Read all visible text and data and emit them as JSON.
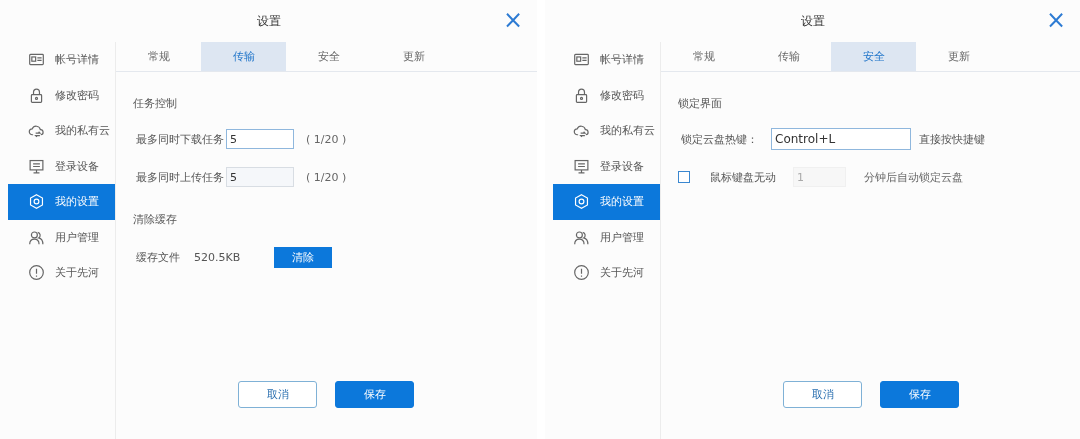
{
  "dialogs": [
    {
      "title": "设置",
      "close": "×",
      "sidebar": [
        {
          "label": "帐号详情",
          "selected": false
        },
        {
          "label": "修改密码",
          "selected": false
        },
        {
          "label": "我的私有云",
          "selected": false
        },
        {
          "label": "登录设备",
          "selected": false
        },
        {
          "label": "我的设置",
          "selected": true
        },
        {
          "label": "用户管理",
          "selected": false
        },
        {
          "label": "关于先河",
          "selected": false
        }
      ],
      "tabs": [
        {
          "label": "常规",
          "selected": false
        },
        {
          "label": "传输",
          "selected": true
        },
        {
          "label": "安全",
          "selected": false
        },
        {
          "label": "更新",
          "selected": false
        }
      ],
      "rows": [
        {
          "kind": "heading",
          "label": "任务控制"
        },
        {
          "kind": "number",
          "label": "最多同时下载任务",
          "value": "5",
          "focused": true,
          "hint": "( 1/20 )"
        },
        {
          "kind": "number",
          "label": "最多同时上传任务",
          "value": "5",
          "focused": false,
          "hint": "( 1/20 )"
        },
        {
          "kind": "heading",
          "label": "清除缓存"
        },
        {
          "kind": "cache",
          "label": "缓存文件",
          "value": "520.5KB",
          "button": "清除"
        }
      ],
      "buttons": [
        {
          "label": "取消",
          "primary": false
        },
        {
          "label": "保存",
          "primary": true
        }
      ]
    },
    {
      "title": "设置",
      "close": "×",
      "sidebar": [
        {
          "label": "帐号详情",
          "selected": false
        },
        {
          "label": "修改密码",
          "selected": false
        },
        {
          "label": "我的私有云",
          "selected": false
        },
        {
          "label": "登录设备",
          "selected": false
        },
        {
          "label": "我的设置",
          "selected": true
        },
        {
          "label": "用户管理",
          "selected": false
        },
        {
          "label": "关于先河",
          "selected": false
        }
      ],
      "tabs": [
        {
          "label": "常规",
          "selected": false
        },
        {
          "label": "传输",
          "selected": false
        },
        {
          "label": "安全",
          "selected": true
        },
        {
          "label": "更新",
          "selected": false
        }
      ],
      "rows": [
        {
          "kind": "heading",
          "label": "锁定界面"
        },
        {
          "kind": "hotkey",
          "label": "锁定云盘热键：",
          "value": "Control+L",
          "hint": "直接按快捷键"
        },
        {
          "kind": "checkbox",
          "checked": false,
          "label": "鼠标键盘无动",
          "value": "1",
          "hint": "分钟后自动锁定云盘"
        }
      ],
      "buttons": [
        {
          "label": "取消",
          "primary": false
        },
        {
          "label": "保存",
          "primary": true
        }
      ]
    }
  ]
}
